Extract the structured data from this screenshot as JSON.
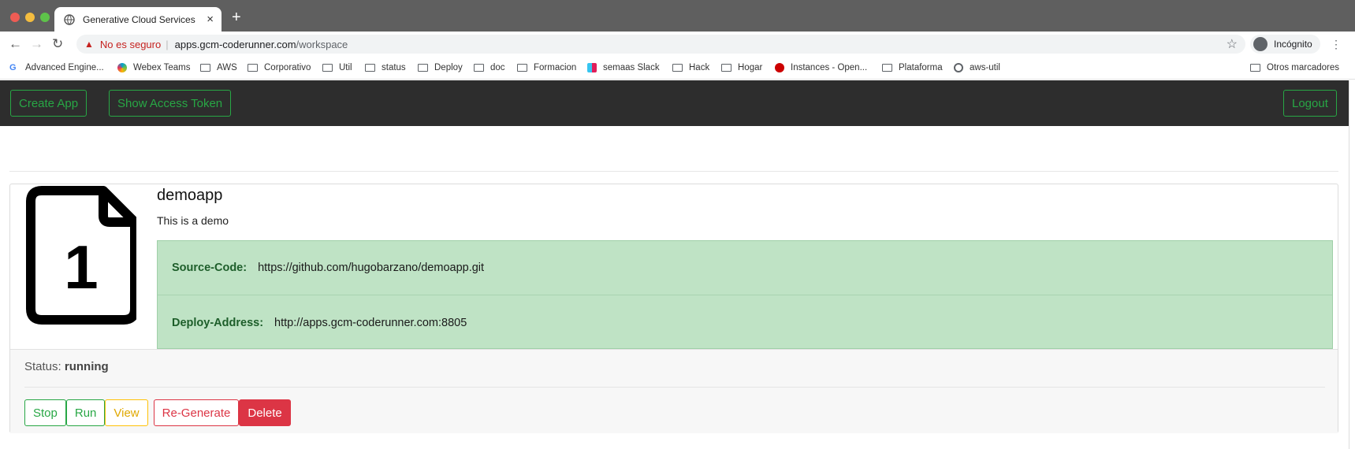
{
  "browser": {
    "tab_title": "Generative Cloud Services",
    "tab_close": "×",
    "new_tab": "+",
    "security_warning": "No es seguro",
    "url_host": "apps.gcm-coderunner.com",
    "url_path": "/workspace",
    "incognito_label": "Incógnito",
    "back_icon": "arrow-left",
    "forward_icon": "arrow-right",
    "reload_icon": "reload",
    "star_icon": "star",
    "bookmarks": [
      {
        "label": "Advanced Engine...",
        "icon": "google-icon"
      },
      {
        "label": "Webex Teams",
        "icon": "webex-icon"
      },
      {
        "label": "AWS",
        "icon": "folder-icon"
      },
      {
        "label": "Corporativo",
        "icon": "folder-icon"
      },
      {
        "label": "Util",
        "icon": "folder-icon"
      },
      {
        "label": "status",
        "icon": "folder-icon"
      },
      {
        "label": "Deploy",
        "icon": "folder-icon"
      },
      {
        "label": "doc",
        "icon": "folder-icon"
      },
      {
        "label": "Formacion",
        "icon": "folder-icon"
      },
      {
        "label": "semaas Slack",
        "icon": "slack-icon"
      },
      {
        "label": "Hack",
        "icon": "folder-icon"
      },
      {
        "label": "Hogar",
        "icon": "folder-icon"
      },
      {
        "label": "Instances - Open...",
        "icon": "redhat-icon"
      },
      {
        "label": "Plataforma",
        "icon": "folder-icon"
      },
      {
        "label": "aws-util",
        "icon": "globe-icon"
      }
    ],
    "other_bookmarks": "Otros marcadores"
  },
  "navbar": {
    "create_app": "Create App",
    "show_token": "Show Access Token",
    "logout": "Logout",
    "accent_color": "#28a745"
  },
  "app": {
    "number": "1",
    "name": "demoapp",
    "description": "This is a demo",
    "source_label": "Source-Code:",
    "source_value": "https://github.com/hugobarzano/demoapp.git",
    "deploy_label": "Deploy-Address:",
    "deploy_value": "http://apps.gcm-coderunner.com:8805",
    "status_label": "Status:",
    "status_value": "running",
    "actions": {
      "stop": "Stop",
      "run": "Run",
      "view": "View",
      "regenerate": "Re-Generate",
      "delete": "Delete"
    }
  }
}
